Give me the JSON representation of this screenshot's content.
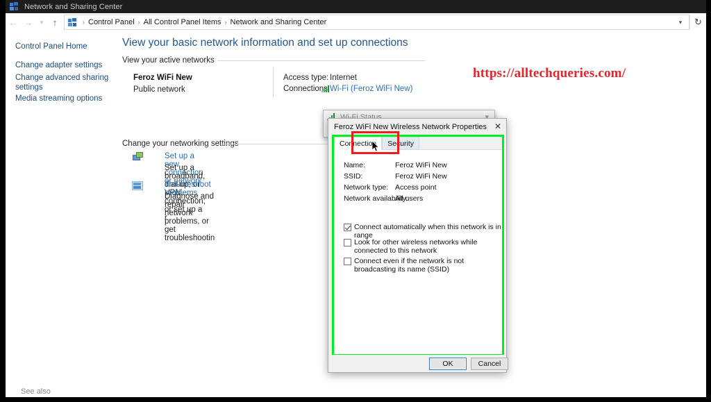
{
  "window": {
    "title": "Network and Sharing Center",
    "title_icon": "network-icon"
  },
  "navbar": {
    "back_icon": "arrow-left-icon",
    "forward_icon": "arrow-right-icon",
    "recent_icon": "chevron-down-icon",
    "up_icon": "arrow-up-icon",
    "address_icon": "network-icon",
    "breadcrumbs": [
      "Control Panel",
      "All Control Panel Items",
      "Network and Sharing Center"
    ],
    "separator": "›",
    "dropdown_icon": "chevron-down-icon",
    "refresh_icon": "refresh-icon"
  },
  "sidebar": {
    "home": "Control Panel Home",
    "items": [
      {
        "label": "Change adapter settings"
      },
      {
        "label": "Change advanced sharing settings"
      },
      {
        "label": "Media streaming options"
      }
    ],
    "see_also": "See also"
  },
  "main": {
    "heading": "View your basic network information and set up connections",
    "active_networks_label": "View your active networks",
    "network": {
      "name": "Feroz WiFi New",
      "type": "Public network",
      "access_type_key": "Access type:",
      "access_type_value": "Internet",
      "connections_key": "Connections:",
      "connections_value": "Wi-Fi (Feroz WiFi New)",
      "connections_icon": "wifi-signal-icon"
    },
    "change_settings_label": "Change your networking settings",
    "tasks": [
      {
        "icon": "new-connection-icon",
        "title": "Set up a new connection or network",
        "desc": "Set up a broadband, dial-up, or VPN connection; or set up a r"
      },
      {
        "icon": "troubleshoot-icon",
        "title": "Troubleshoot problems",
        "desc": "Diagnose and repair network problems, or get troubleshootin"
      }
    ]
  },
  "watermark": {
    "text": "https://alltechqueries.com/",
    "color": "#e8232a"
  },
  "wifi_status_window": {
    "title": "Wi-Fi Status",
    "icon": "wifi-signal-icon",
    "chevron_icon": "chevron-down-icon"
  },
  "dialog": {
    "title": "Feroz WiFi New Wireless Network Properties",
    "close_icon": "close-icon",
    "tabs": [
      {
        "label": "Connection",
        "state": "active"
      },
      {
        "label": "Security",
        "state": "hover"
      }
    ],
    "fields": [
      {
        "key": "Name:",
        "value": "Feroz WiFi New"
      },
      {
        "key": "SSID:",
        "value": "Feroz WiFi New"
      },
      {
        "key": "Network type:",
        "value": "Access point"
      },
      {
        "key": "Network availability:",
        "value": "All users"
      }
    ],
    "checkboxes": [
      {
        "label": "Connect automatically when this network is in range",
        "checked": true
      },
      {
        "label": "Look for other wireless networks while connected to this network",
        "checked": false
      },
      {
        "label": "Connect even if the network is not broadcasting its name (SSID)",
        "checked": false
      }
    ],
    "buttons": {
      "ok": "OK",
      "cancel": "Cancel"
    },
    "highlight_border_color": "#00ef21"
  },
  "annotation": {
    "box_color": "#ee1d1d",
    "cursor_icon": "mouse-pointer-icon"
  }
}
